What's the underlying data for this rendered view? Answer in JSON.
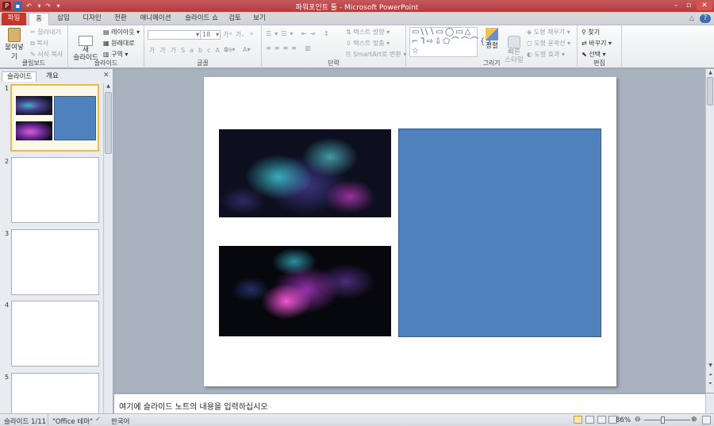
{
  "window": {
    "title": "파워포인트 툴 - Microsoft PowerPoint"
  },
  "tabs": [
    {
      "label": "파일"
    },
    {
      "label": "홈"
    },
    {
      "label": "삽입"
    },
    {
      "label": "디자인"
    },
    {
      "label": "전환"
    },
    {
      "label": "애니메이션"
    },
    {
      "label": "슬라이드 쇼"
    },
    {
      "label": "검토"
    },
    {
      "label": "보기"
    }
  ],
  "ribbon": {
    "clipboard": {
      "label": "클립보드",
      "paste": "붙여넣기",
      "cut": "잘라내기",
      "copy": "복사",
      "format_painter": "서식 복사"
    },
    "slides": {
      "label": "슬라이드",
      "new_slide": "새\n슬라이드",
      "layout": "레이아웃",
      "reset": "원래대로",
      "section": "구역"
    },
    "font": {
      "label": "글꼴",
      "font_name": "",
      "font_size": "18"
    },
    "paragraph": {
      "label": "단락",
      "text_direction": "텍스트 방향",
      "align_text": "텍스트 맞춤",
      "smartart": "SmartArt로 변환"
    },
    "drawing": {
      "label": "그리기",
      "arrange": "정렬",
      "quick_styles": "빠른\n스타일",
      "shape_fill": "도형 채우기",
      "shape_outline": "도형 윤곽선",
      "shape_effects": "도형 효과"
    },
    "editing": {
      "label": "편집",
      "find": "찾기",
      "replace": "바꾸기",
      "select": "선택"
    }
  },
  "leftpane": {
    "tab_slides": "슬라이드",
    "tab_outline": "개요",
    "slides": [
      {
        "num": "1"
      },
      {
        "num": "2"
      },
      {
        "num": "3"
      },
      {
        "num": "4"
      },
      {
        "num": "5"
      }
    ]
  },
  "notes": {
    "placeholder": "여기에 슬라이드 노트의 내용을 입력하십시오"
  },
  "status": {
    "slide": "슬라이드 1/11",
    "theme": "\"Office 테마\"",
    "language": "한국어",
    "zoom": "86%"
  },
  "colors": {
    "accent_title": "#b73a3d",
    "rect_fill": "#4f81bd",
    "rect_border": "#385d8a"
  }
}
